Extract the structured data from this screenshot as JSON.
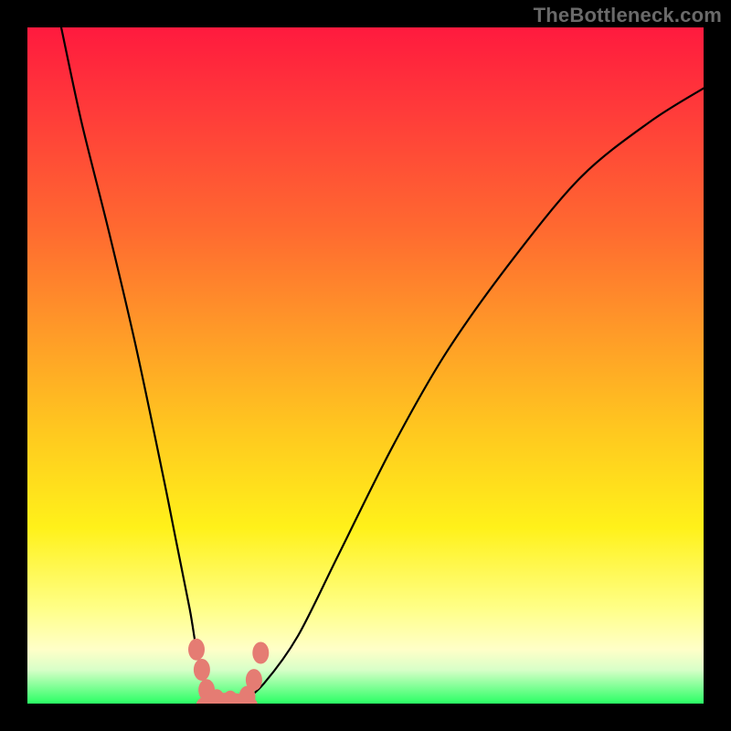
{
  "watermark": "TheBottleneck.com",
  "chart_data": {
    "type": "line",
    "title": "",
    "xlabel": "",
    "ylabel": "",
    "xlim": [
      0,
      100
    ],
    "ylim": [
      0,
      100
    ],
    "grid": false,
    "legend": false,
    "series": [
      {
        "name": "curve",
        "x": [
          5,
          8,
          12,
          16,
          20,
          22,
          24,
          25,
          26,
          27,
          28,
          30,
          32,
          35,
          40,
          46,
          54,
          62,
          72,
          82,
          92,
          100
        ],
        "y": [
          100,
          86,
          70,
          53,
          34,
          24,
          14,
          8,
          4,
          1.5,
          0.5,
          0,
          0.5,
          3,
          10,
          22,
          38,
          52,
          66,
          78,
          86,
          91
        ]
      }
    ],
    "markers": [
      {
        "x": 25.0,
        "y": 8.0
      },
      {
        "x": 25.8,
        "y": 5.0
      },
      {
        "x": 26.5,
        "y": 2.0
      },
      {
        "x": 28.0,
        "y": 0.5
      },
      {
        "x": 30.0,
        "y": 0.3
      },
      {
        "x": 32.5,
        "y": 1.0
      },
      {
        "x": 33.5,
        "y": 3.5
      },
      {
        "x": 34.5,
        "y": 7.5
      }
    ],
    "pill": {
      "cx": 29.5,
      "cy": 0.0,
      "rx": 4.5,
      "ry": 1.6
    }
  }
}
